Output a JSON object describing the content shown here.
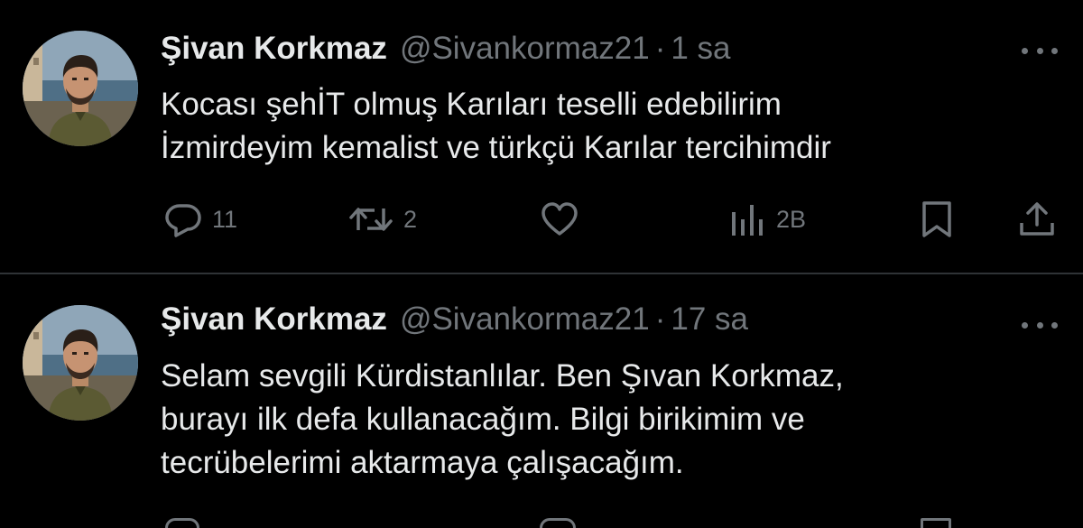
{
  "tweets": [
    {
      "display_name": "Şivan Korkmaz",
      "handle": "@Sivankormaz21",
      "separator": "·",
      "time": "1 sa",
      "text_lines": [
        "Kocası şehİT olmuş Karıları teselli edebilirim",
        "İzmirdeyim kemalist ve türkçü Karılar tercihimdir"
      ],
      "reply_count": "11",
      "retweet_count": "2",
      "like_count": "",
      "views_count": "2B"
    },
    {
      "display_name": "Şivan Korkmaz",
      "handle": "@Sivankormaz21",
      "separator": "·",
      "time": "17 sa",
      "text_lines": [
        "Selam sevgili Kürdistanlılar. Ben Şıvan Korkmaz,",
        "burayı ilk defa kullanacağım. Bilgi birikimim ve",
        "tecrübelerimi aktarmaya çalışacağım."
      ]
    }
  ],
  "icons": {
    "reply": "speech-bubble-icon",
    "retweet": "retweet-arrows-icon",
    "like": "heart-icon",
    "views": "bar-chart-icon",
    "bookmark": "bookmark-icon",
    "share": "share-upload-icon",
    "more": "more-dots-icon"
  },
  "colors": {
    "background": "#000000",
    "primary_text": "#e7e9ea",
    "secondary_text": "#71767b",
    "divider": "#2f3336"
  }
}
